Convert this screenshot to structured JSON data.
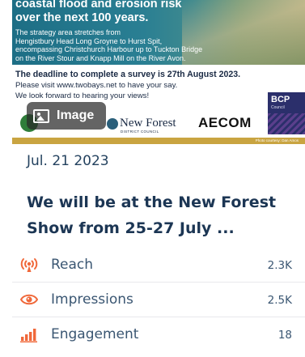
{
  "banner": {
    "headline_l1": "coastal flood and erosion risk",
    "headline_l2": "over the next 100 years.",
    "body_l1": "The strategy area stretches from",
    "body_l2": "Hengistbury Head Long Groyne to Hurst Spit,",
    "body_l3": "encompassing Christchurch Harbour up to Tuckton Bridge",
    "body_l4": "on the River Stour and Knapp Mill on the River Avon.",
    "deadline": "The deadline to complete a survey is 27th August 2023.",
    "visit": "Please visit www.twobays.net to have your say.",
    "forward": "We look forward to hearing your views!",
    "image_chip_label": "Image",
    "nf_name": "New Forest",
    "nf_sub": "DISTRICT COUNCIL",
    "aecom": "AECOM",
    "bcp": "BCP",
    "bcp_sub": "Council",
    "photo_credit": "Photo courtesy: Dan Amos"
  },
  "post": {
    "date": "Jul. 21 2023",
    "headline": "We will be at the New Forest Show from 25-27 July ..."
  },
  "metrics": [
    {
      "icon": "reach-icon",
      "label": "Reach",
      "value": "2.3K"
    },
    {
      "icon": "eye-icon",
      "label": "Impressions",
      "value": "2.5K"
    },
    {
      "icon": "bar-chart-icon",
      "label": "Engagement",
      "value": "18"
    }
  ],
  "colors": {
    "accent": "#f0683a",
    "text": "#1c3654",
    "gold_bar": "#c9a441"
  }
}
